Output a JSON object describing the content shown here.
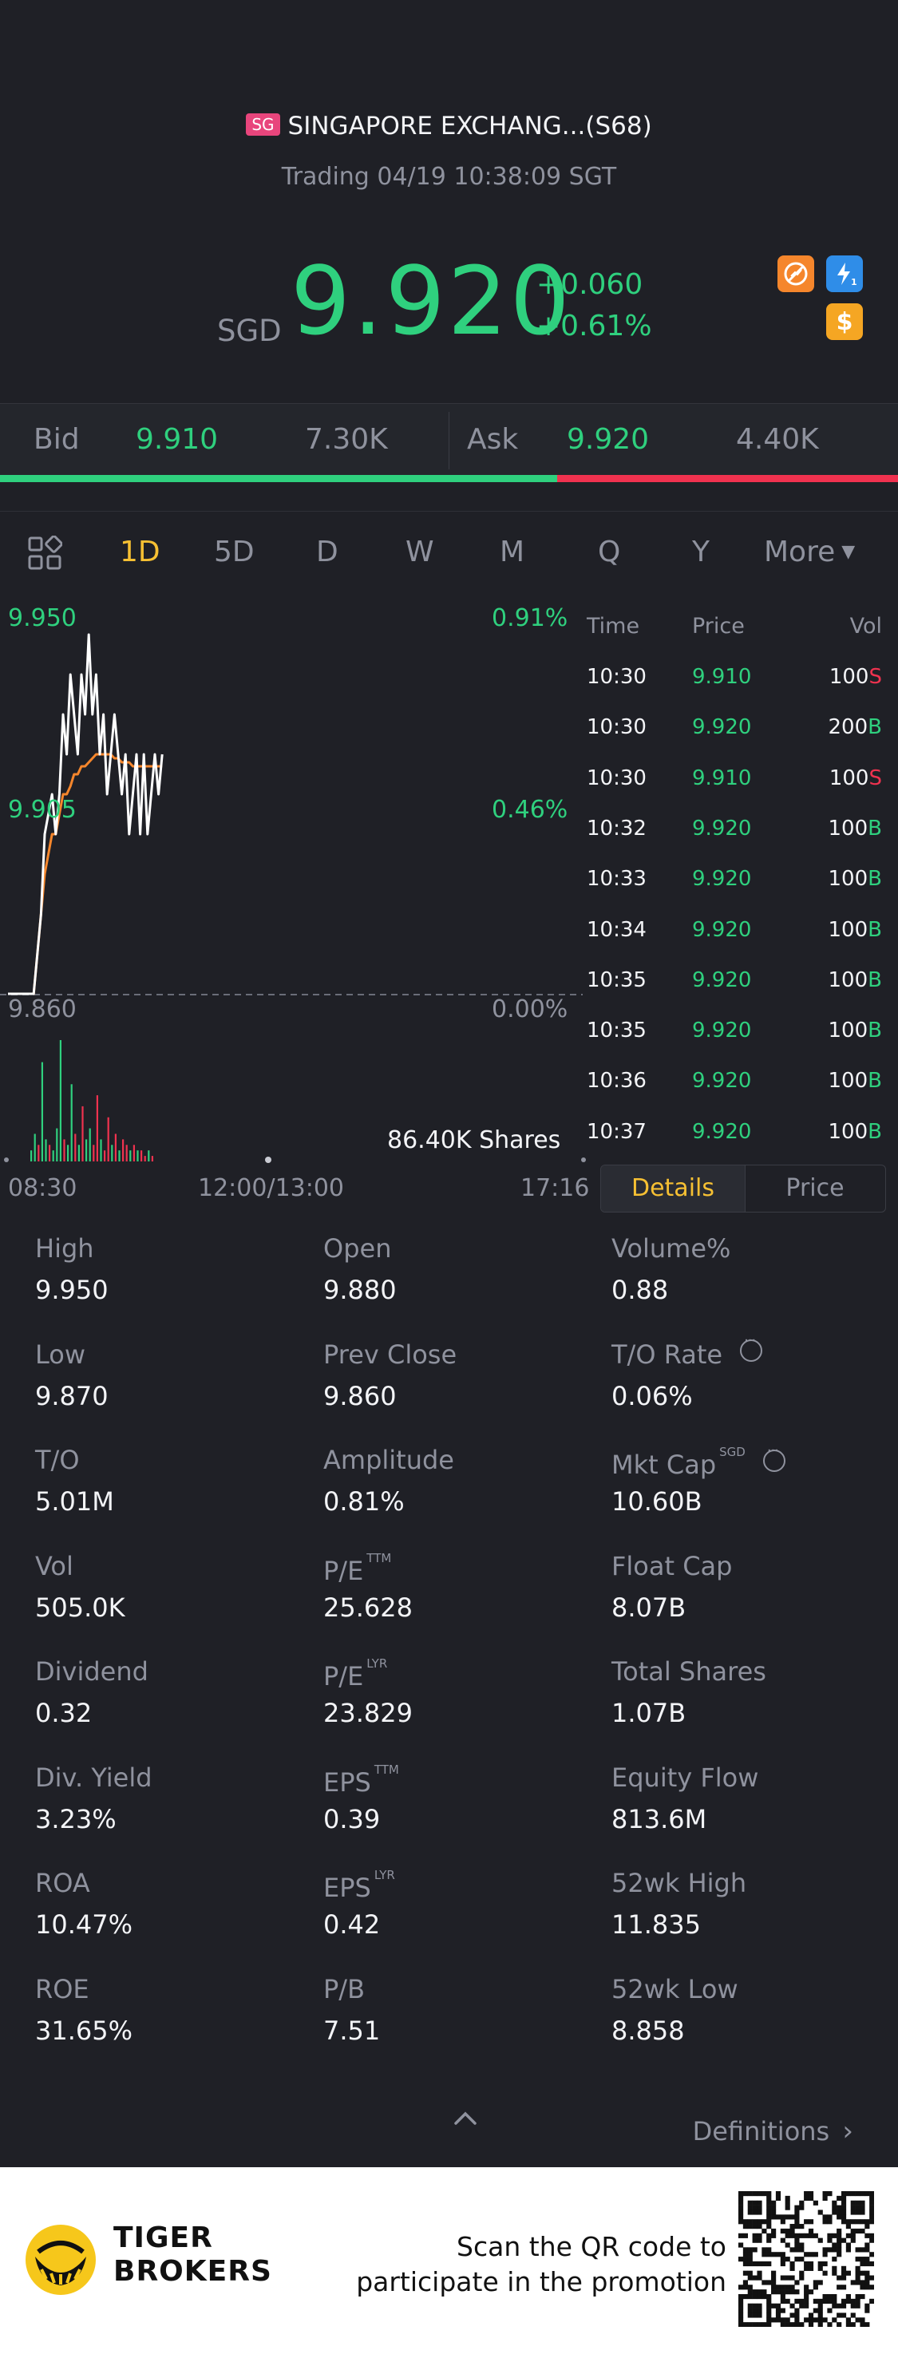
{
  "header": {
    "exchange_badge": "SG",
    "title": "SINGAPORE EXCHANG...(S68)",
    "status": "Trading 04/19 10:38:09 SGT",
    "currency": "SGD",
    "price": "9.920",
    "change_abs": "+0.060",
    "change_pct": "+0.61%",
    "icons": [
      "no-short-icon",
      "level1-icon",
      "dollar-icon"
    ],
    "up_color": "#2fd07e",
    "down_color": "#f0324f"
  },
  "bidask": {
    "bid_label": "Bid",
    "bid_price": "9.910",
    "bid_size": "7.30K",
    "ask_label": "Ask",
    "ask_price": "9.920",
    "ask_size": "4.40K",
    "bid_ratio": 0.62
  },
  "tabs": {
    "items": [
      "1D",
      "5D",
      "D",
      "W",
      "M",
      "Q",
      "Y"
    ],
    "active": "1D",
    "more_label": "More"
  },
  "chart": {
    "y_top_label": "9.950",
    "y_mid_label": "9.905",
    "y_base_label": "9.860",
    "pct_top_label": "0.91%",
    "pct_mid_label": "0.46%",
    "pct_base_label": "0.00%",
    "volume_label": "86.40K Shares",
    "x_labels": [
      "08:30",
      "12:00/13:00",
      "17:16"
    ]
  },
  "chart_data": {
    "type": "line",
    "title": "",
    "xlabel": "",
    "ylabel": "",
    "ylim": [
      9.86,
      9.95
    ],
    "series": [
      {
        "values": [
          9.86,
          9.86,
          9.86,
          9.86,
          9.86,
          9.86,
          9.86,
          9.86,
          9.87,
          9.88,
          9.9,
          9.905,
          9.91,
          9.9,
          9.91,
          9.93,
          9.92,
          9.94,
          9.93,
          9.92,
          9.94,
          9.93,
          9.95,
          9.93,
          9.94,
          9.92,
          9.93,
          9.91,
          9.92,
          9.93,
          9.92,
          9.91,
          9.92,
          9.9,
          9.91,
          9.92,
          9.9,
          9.92,
          9.9,
          9.91,
          9.92,
          9.91,
          9.92
        ]
      },
      {
        "values": [
          9.86,
          9.86,
          9.86,
          9.86,
          9.86,
          9.86,
          9.86,
          9.86,
          9.87,
          9.88,
          9.89,
          9.895,
          9.9,
          9.9,
          9.905,
          9.91,
          9.91,
          9.912,
          9.915,
          9.915,
          9.917,
          9.917,
          9.918,
          9.919,
          9.92,
          9.92,
          9.92,
          9.92,
          9.92,
          9.919,
          9.919,
          9.918,
          9.918,
          9.918,
          9.917,
          9.917,
          9.917,
          9.917,
          9.917,
          9.917,
          9.917,
          9.917,
          9.917
        ]
      }
    ],
    "volume": [
      2,
      5,
      3,
      18,
      4,
      3,
      2,
      6,
      22,
      4,
      3,
      14,
      5,
      3,
      10,
      4,
      6,
      3,
      12,
      4,
      2,
      8,
      3,
      5,
      2,
      4,
      3,
      2,
      3,
      2,
      2,
      1,
      2,
      1
    ],
    "volume_colors": [
      "g",
      "g",
      "r",
      "g",
      "g",
      "r",
      "g",
      "g",
      "g",
      "r",
      "g",
      "g",
      "r",
      "g",
      "r",
      "g",
      "g",
      "r",
      "r",
      "g",
      "r",
      "r",
      "g",
      "r",
      "g",
      "r",
      "r",
      "g",
      "r",
      "g",
      "r",
      "r",
      "g",
      "r"
    ],
    "colors": {
      "price_line": "#ffffff",
      "avg_line": "#f5862c"
    }
  },
  "ticks": {
    "headers": {
      "time": "Time",
      "price": "Price",
      "vol": "Vol"
    },
    "rows": [
      {
        "time": "10:30",
        "price": "9.910",
        "vol": "100",
        "side": "S"
      },
      {
        "time": "10:30",
        "price": "9.920",
        "vol": "200",
        "side": "B"
      },
      {
        "time": "10:30",
        "price": "9.910",
        "vol": "100",
        "side": "S"
      },
      {
        "time": "10:32",
        "price": "9.920",
        "vol": "100",
        "side": "B"
      },
      {
        "time": "10:33",
        "price": "9.920",
        "vol": "100",
        "side": "B"
      },
      {
        "time": "10:34",
        "price": "9.920",
        "vol": "100",
        "side": "B"
      },
      {
        "time": "10:35",
        "price": "9.920",
        "vol": "100",
        "side": "B"
      },
      {
        "time": "10:35",
        "price": "9.920",
        "vol": "100",
        "side": "B"
      },
      {
        "time": "10:36",
        "price": "9.920",
        "vol": "100",
        "side": "B"
      },
      {
        "time": "10:37",
        "price": "9.920",
        "vol": "100",
        "side": "B"
      }
    ]
  },
  "toggle": {
    "details": "Details",
    "price": "Price"
  },
  "stats": [
    [
      {
        "label": "High",
        "value": "9.950"
      },
      {
        "label": "Open",
        "value": "9.880"
      },
      {
        "label": "Volume%",
        "value": "0.88"
      }
    ],
    [
      {
        "label": "Low",
        "value": "9.870"
      },
      {
        "label": "Prev Close",
        "value": "9.860"
      },
      {
        "label": "T/O Rate",
        "value": "0.06%",
        "info": true
      }
    ],
    [
      {
        "label": "T/O",
        "value": "5.01M"
      },
      {
        "label": "Amplitude",
        "value": "0.81%"
      },
      {
        "label": "Mkt Cap",
        "sup": "SGD",
        "value": "10.60B",
        "info": true
      }
    ],
    [
      {
        "label": "Vol",
        "value": "505.0K"
      },
      {
        "label": "P/E",
        "sup": "TTM",
        "value": "25.628"
      },
      {
        "label": "Float Cap",
        "value": "8.07B"
      }
    ],
    [
      {
        "label": "Dividend",
        "value": "0.32"
      },
      {
        "label": "P/E",
        "sup": "LYR",
        "value": "23.829"
      },
      {
        "label": "Total Shares",
        "value": "1.07B"
      }
    ],
    [
      {
        "label": "Div. Yield",
        "value": "3.23%"
      },
      {
        "label": "EPS",
        "sup": "TTM",
        "value": "0.39"
      },
      {
        "label": "Equity Flow",
        "value": "813.6M"
      }
    ],
    [
      {
        "label": "ROA",
        "value": "10.47%"
      },
      {
        "label": "EPS",
        "sup": "LYR",
        "value": "0.42"
      },
      {
        "label": "52wk High",
        "value": "11.835"
      }
    ],
    [
      {
        "label": "ROE",
        "value": "31.65%"
      },
      {
        "label": "P/B",
        "value": "7.51"
      },
      {
        "label": "52wk Low",
        "value": "8.858"
      }
    ]
  ],
  "definitions_label": "Definitions",
  "footer": {
    "brand_line1": "TIGER",
    "brand_line2": "BROKERS",
    "scan_line1": "Scan the QR code to",
    "scan_line2": "participate in the promotion"
  }
}
